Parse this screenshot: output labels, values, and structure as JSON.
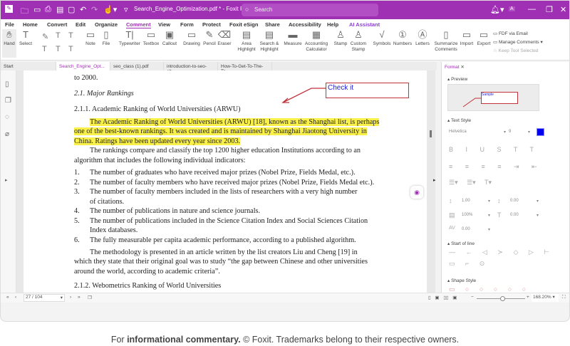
{
  "titlebar": {
    "title": "Search_Engine_Optimization.pdf * - Foxit PDF Editor",
    "search_placeholder": "Search",
    "accent": "#9f30b3",
    "user_initial": "A"
  },
  "menu": [
    "File",
    "Home",
    "Convert",
    "Edit",
    "Organize",
    "Comment",
    "View",
    "Form",
    "Protect",
    "Foxit eSign",
    "Share",
    "Accessibility",
    "Help",
    "AI Assistant"
  ],
  "ribbon": {
    "hand": "Hand",
    "select": "Select",
    "note": "Note",
    "file": "File",
    "typewriter": "Typewriter",
    "textbox": "Textbox",
    "callout": "Callout",
    "drawing": "Drawing",
    "pencil": "Pencil",
    "eraser": "Eraser",
    "area_highlight": "Area Highlight",
    "search_highlight": "Search & Highlight",
    "measure": "Measure",
    "accounting": "Accounting Calculator",
    "stamp": "Stamp",
    "custom_stamp": "Custom Stamp",
    "symbols": "Symbols",
    "numbers": "Numbers",
    "letters": "Letters",
    "summarize": "Summarize Comments",
    "import": "Import",
    "export": "Export",
    "fdf_email": "FDF via Email",
    "manage_comments": "Manage Comments",
    "keep_tool": "Keep Tool Selected"
  },
  "doc_tabs": [
    "Start",
    "Search_Engine_Opt...",
    "seo_class (1).pdf",
    "introduction-to-seo-eb...",
    "How-To-Get-To-The-To..."
  ],
  "document": {
    "lines": [
      "to 2000.",
      "2.1. Major Rankings",
      "2.1.1. Academic Ranking of World Universities (ARWU)"
    ],
    "highlight": [
      "The Academic Ranking of World Universities (ARWU) [18], known as the Shanghai list, is perhaps",
      "one of the best-known rankings. It was created and is maintained by Shanghai Jiaotong University in",
      "China. Ratings have been updated every year since 2003."
    ],
    "para1": [
      "The rankings compare and classify the top 1200 higher education Institutions according to an",
      "algorithm that includes the following individual indicators:"
    ],
    "list": [
      {
        "n": "1.",
        "t": [
          "The number of graduates who have received major prizes (Nobel Prize, Fields Medal, etc.)."
        ]
      },
      {
        "n": "2.",
        "t": [
          "The number of faculty members who have received major prizes (Nobel Prize, Fields Medal etc.)."
        ]
      },
      {
        "n": "3.",
        "t": [
          "The number of faculty members included in the lists of researchers with a very high number",
          "of citations."
        ]
      },
      {
        "n": "4.",
        "t": [
          "The number of publications in nature and science journals."
        ]
      },
      {
        "n": "5.",
        "t": [
          "The number of publications included in the Science Citation Index and Social Sciences Citation",
          "Index databases."
        ]
      },
      {
        "n": "6.",
        "t": [
          "The fully measurable per capita academic performance, according to a published algorithm."
        ]
      }
    ],
    "para2": [
      "The methodology is presented in an article written by the list creators Liu and Cheng [19] in",
      "which they state that their original goal was to study “the gap between Chinese and other universities",
      "around the world, according to academic criteria”."
    ],
    "heading2": "2.1.2. Webometrics Ranking of World Universities",
    "callout_text": "Check it",
    "highlight_color": "#f9f04a",
    "callout_color": "#c0333a"
  },
  "panel": {
    "tab": "Format",
    "preview": "Preview",
    "preview_sample": "Sample",
    "text_style": "Text Style",
    "font": "Helvetica",
    "size": "9",
    "color": "#0000ee",
    "line_spacing": "1.00",
    "para_spacing": "0.00",
    "scale": "100%",
    "indent": "0.00",
    "char_spacing": "0.00",
    "start_of_line": "Start of line",
    "shape_style": "Shape Style"
  },
  "status": {
    "page": "27 / 104",
    "zoom": "168.20%",
    "zoom_level": 0.55
  },
  "footer": {
    "pre": "For ",
    "bold": "informational commentary.",
    "post": " © Foxit. Trademarks belong to their respective owners."
  }
}
